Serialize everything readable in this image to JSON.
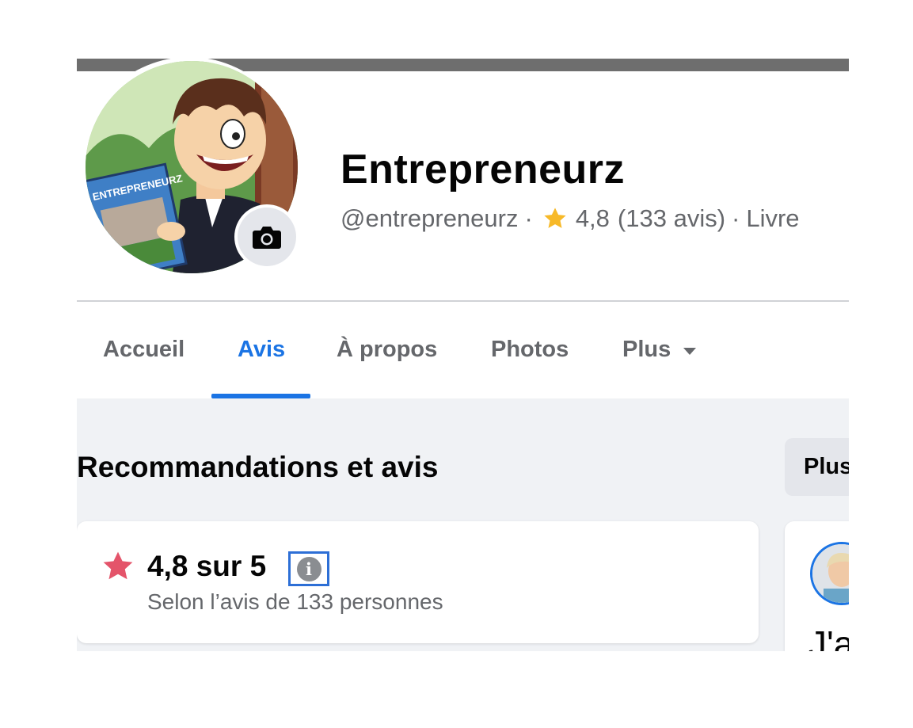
{
  "profile": {
    "name": "Entrepreneurz",
    "handle": "@entrepreneurz",
    "rating": "4,8",
    "reviews_count": "(133 avis)",
    "category": "Livre",
    "separator": "·",
    "comic_cover_text": "ENTREPRENEURZ"
  },
  "tabs": [
    {
      "label": "Accueil",
      "active": false
    },
    {
      "label": "Avis",
      "active": true
    },
    {
      "label": "À propos",
      "active": false
    },
    {
      "label": "Photos",
      "active": false
    },
    {
      "label": "Plus",
      "active": false
    }
  ],
  "reviews_section": {
    "title": "Recommandations et avis",
    "plus_button": "Plus",
    "rating_text": "4,8 sur 5",
    "rating_subtitle": "Selon l’avis de 133 personnes",
    "info_icon_glyph": "i",
    "review_snippet": "J'a"
  },
  "colors": {
    "accent": "#1b74e4",
    "star_gold": "#f7b928",
    "star_red": "#e4546a",
    "muted_text": "#65676b",
    "content_bg": "#f0f2f5"
  },
  "icons": {
    "camera": "camera-icon",
    "star": "star-icon",
    "info": "info-icon",
    "caret": "caret-down-icon"
  }
}
